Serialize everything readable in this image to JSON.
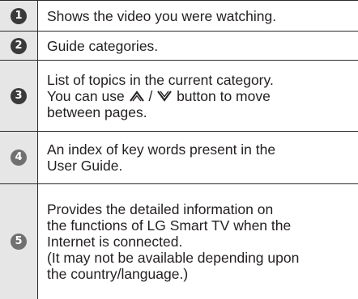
{
  "rows": [
    {
      "number": "1",
      "lines": [
        "Shows the video you were watching."
      ]
    },
    {
      "number": "2",
      "lines": [
        "Guide categories."
      ]
    },
    {
      "number": "3",
      "lines": [
        "List of topics in the current category.",
        "You can use",
        "/",
        "button to move",
        "between pages."
      ]
    },
    {
      "number": "4",
      "lines": [
        "An index of key words present in the",
        "User Guide."
      ]
    },
    {
      "number": "5",
      "lines": [
        "Provides the detailed information on",
        "the functions of LG Smart TV when the",
        "Internet is connected.",
        "(It may not be available depending upon",
        "the country/language.)"
      ]
    }
  ],
  "icons": {
    "up_button": "chevron-up-icon",
    "down_button": "chevron-down-icon"
  },
  "colors": {
    "number_column_bg": "#e6e6e6",
    "text": "#231f20",
    "border": "#2b2b2b"
  }
}
